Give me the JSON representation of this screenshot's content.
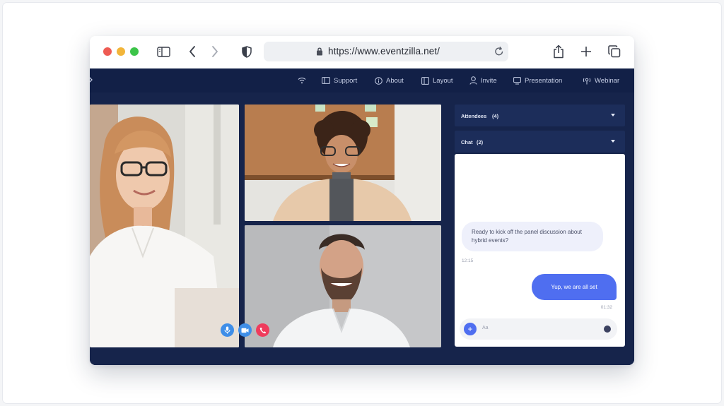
{
  "browser": {
    "url": "https://www.eventzilla.net/",
    "icons": [
      "sidebar-toggle-icon",
      "back-icon",
      "forward-icon",
      "shield-icon",
      "lock-icon",
      "reload-icon",
      "share-icon",
      "new-tab-icon",
      "tabs-icon"
    ]
  },
  "app_nav": {
    "items": [
      {
        "label": "",
        "icon": "wifi-icon"
      },
      {
        "label": "Support",
        "icon": "support-icon"
      },
      {
        "label": "About",
        "icon": "info-icon"
      },
      {
        "label": "Layout",
        "icon": "layout-icon"
      },
      {
        "label": "Invite",
        "icon": "user-icon"
      },
      {
        "label": "Presentation",
        "icon": "monitor-icon"
      },
      {
        "label": "Webinar",
        "icon": "webinar-icon"
      }
    ]
  },
  "call_controls": [
    {
      "name": "microphone-icon",
      "color": "#3f8ee8"
    },
    {
      "name": "camera-icon",
      "color": "#3f8ee8"
    },
    {
      "name": "hang-up-icon",
      "color": "#ef3b5c"
    }
  ],
  "panels": {
    "attendees": {
      "label": "Attendees",
      "count": "(4)"
    },
    "chat": {
      "label": "Chat",
      "count": "(2)"
    }
  },
  "chat": {
    "messages": [
      {
        "direction": "in",
        "text": "Ready to kick off the panel discussion about hybrid events?",
        "time": "12:15"
      },
      {
        "direction": "out",
        "text": "Yup, we are all set",
        "time": "01:32"
      }
    ],
    "input_placeholder": "Aa"
  },
  "colors": {
    "app_background": "#16244b",
    "nav_background": "#122047",
    "accent": "#4f6ef0",
    "hang_up": "#ef3b5c"
  }
}
